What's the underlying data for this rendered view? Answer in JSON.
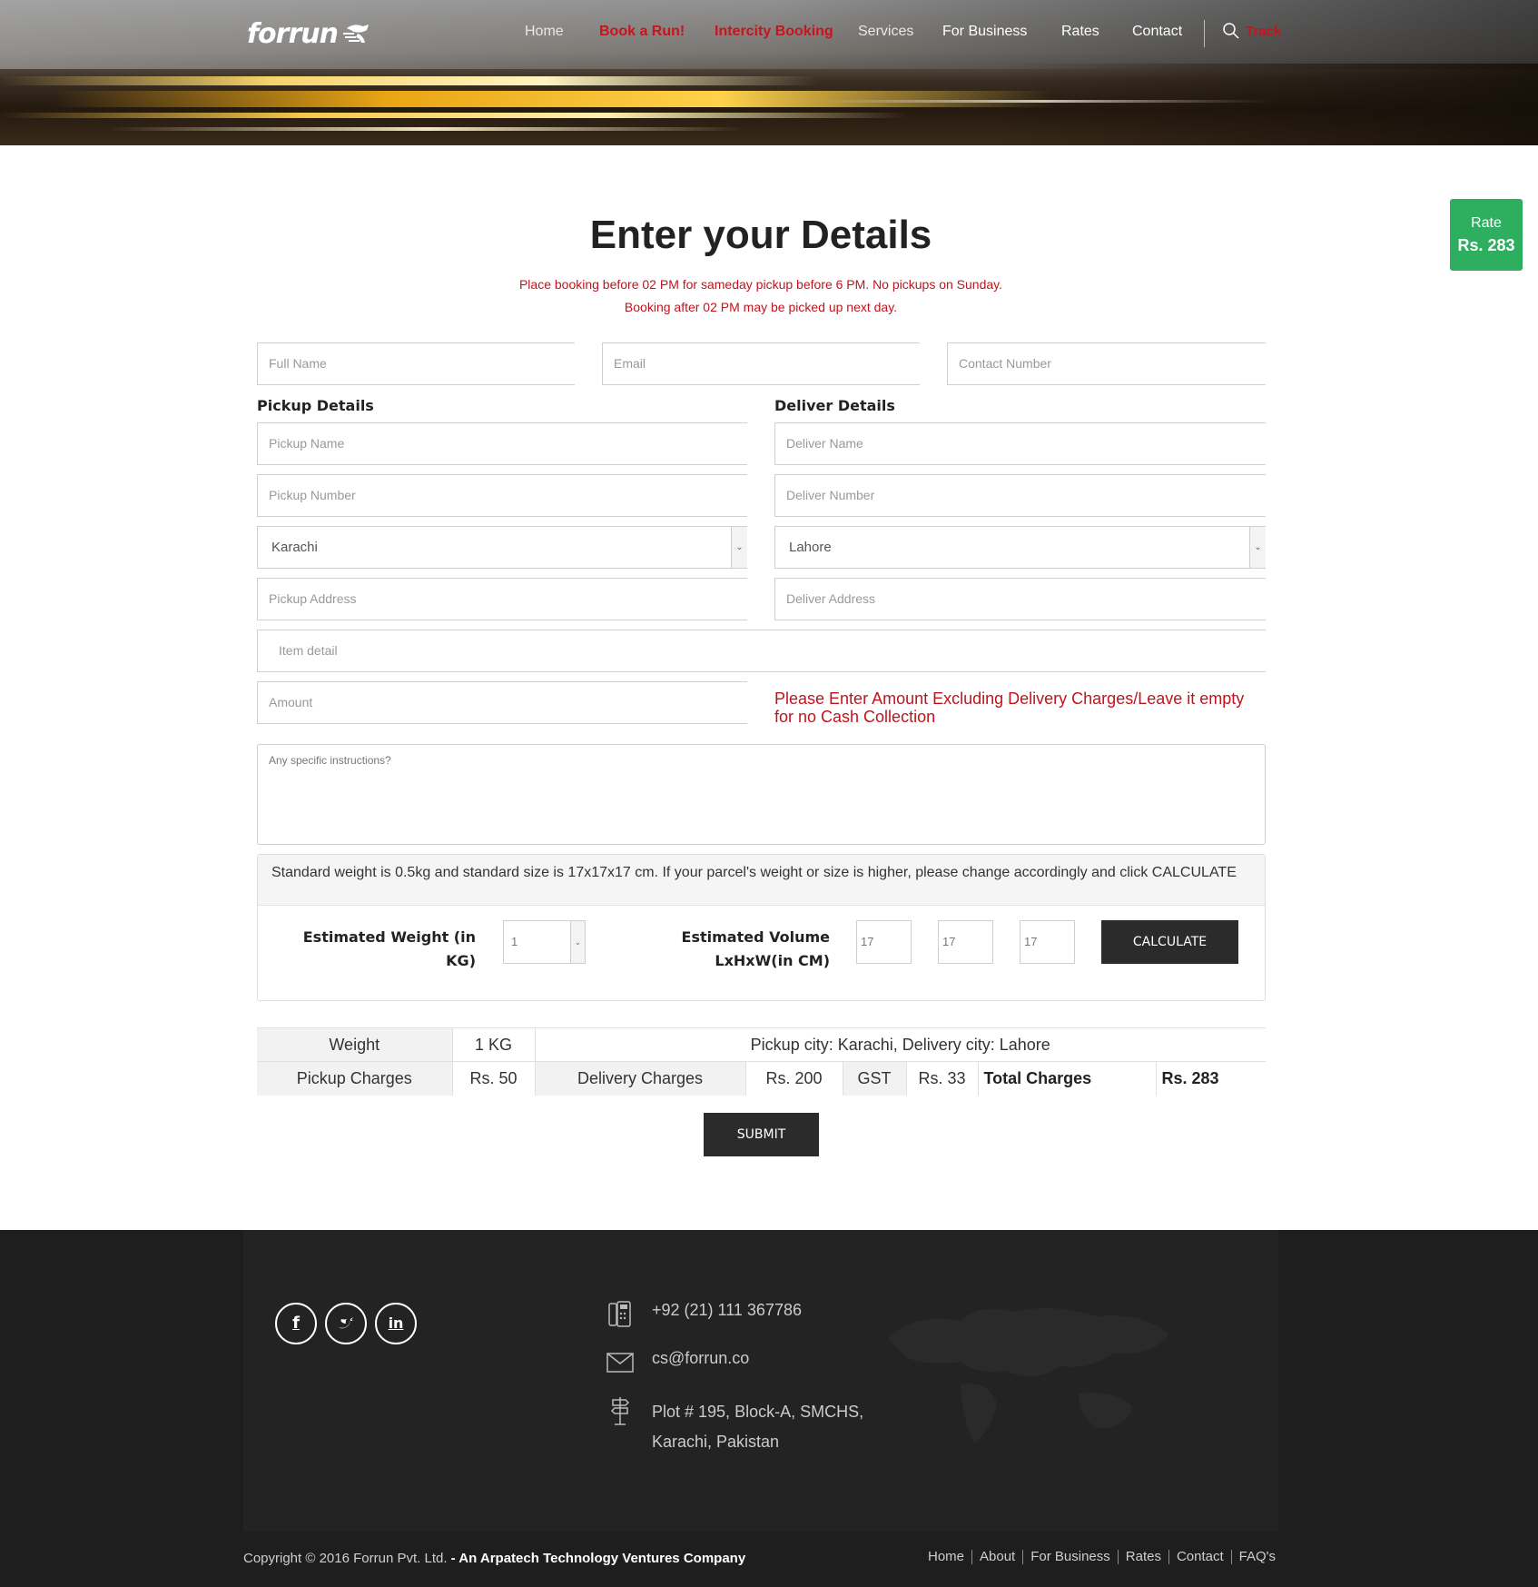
{
  "header": {
    "logo_text": "forrun",
    "nav": [
      {
        "label": "Home"
      },
      {
        "label": "Book a Run!"
      },
      {
        "label": "Intercity Booking"
      },
      {
        "label": "Services"
      },
      {
        "label": "For Business"
      },
      {
        "label": "Rates"
      },
      {
        "label": "Contact"
      }
    ],
    "track_label": "Track"
  },
  "rate_badge": {
    "label": "Rate",
    "value": "Rs. 283",
    "color": "#2eaf5f"
  },
  "form": {
    "title": "Enter your Details",
    "notice_line1": "Place booking before 02 PM for sameday pickup before 6 PM. No pickups on Sunday.",
    "notice_line2": "Booking after 02 PM may be picked up next day.",
    "full_name_placeholder": "Full Name",
    "email_placeholder": "Email",
    "contact_placeholder": "Contact Number",
    "pickup": {
      "heading": "Pickup Details",
      "name_placeholder": "Pickup Name",
      "number_placeholder": "Pickup Number",
      "city": "Karachi",
      "address_placeholder": "Pickup Address"
    },
    "deliver": {
      "heading": "Deliver Details",
      "name_placeholder": "Deliver Name",
      "number_placeholder": "Deliver Number",
      "city": "Lahore",
      "address_placeholder": "Deliver Address"
    },
    "item_placeholder": "Item detail",
    "amount_placeholder": "Amount",
    "amount_note": "Please Enter Amount Excluding Delivery Charges/Leave it empty for no Cash Collection",
    "instructions_placeholder": "Any specific instructions?",
    "calc": {
      "note": "Standard weight is 0.5kg and standard size is 17x17x17 cm. If your parcel's weight or size is higher, please change accordingly and click CALCULATE",
      "weight_label": "Estimated Weight (in KG)",
      "weight_value": "1",
      "volume_label_1": "Estimated Volume",
      "volume_label_2": "LxHxW(in CM)",
      "length": "17",
      "height": "17",
      "width": "17",
      "button": "CALCULATE"
    },
    "summary": {
      "weight_label": "Weight",
      "weight_value": "1 KG",
      "cities": "Pickup city: Karachi, Delivery city: Lahore",
      "pickup_label": "Pickup Charges",
      "pickup_value": "Rs. 50",
      "delivery_label": "Delivery Charges",
      "delivery_value": "Rs. 200",
      "gst_label": "GST",
      "gst_value": "Rs. 33",
      "total_label": "Total Charges",
      "total_value": "Rs. 283"
    },
    "submit": "SUBMIT"
  },
  "footer": {
    "social": [
      {
        "icon": "facebook-icon",
        "glyph": "f"
      },
      {
        "icon": "twitter-icon",
        "glyph": "🐦"
      },
      {
        "icon": "linkedin-icon",
        "glyph": "in"
      }
    ],
    "phone": "+92 (21) 111 367786",
    "email": "cs@forrun.co",
    "address_line1": "Plot # 195, Block-A, SMCHS,",
    "address_line2": "Karachi, Pakistan",
    "copyright_text": "Copyright © 2016 Forrun Pvt. Ltd. ",
    "copyright_bold": "- An Arpatech Technology Ventures Company",
    "links": [
      {
        "label": "Home"
      },
      {
        "label": "About"
      },
      {
        "label": "For Business"
      },
      {
        "label": "Rates"
      },
      {
        "label": "Contact"
      },
      {
        "label": "FAQ's"
      }
    ]
  },
  "colors": {
    "accent_red": "#c8141c",
    "dark": "#2b2b2b",
    "footer_bg": "#1e1e1e"
  }
}
